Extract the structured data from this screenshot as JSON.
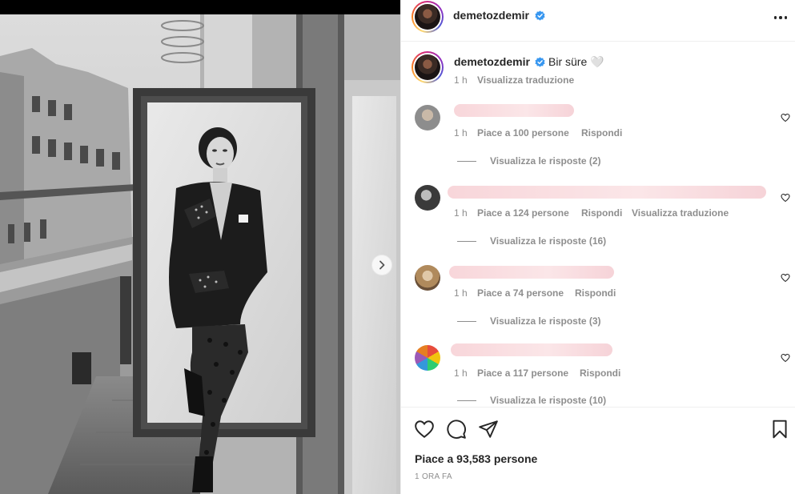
{
  "post": {
    "username": "demetozdemir",
    "caption": "Bir süre 🤍",
    "caption_time": "1 h",
    "translate_label": "Visualizza traduzione",
    "likes_label": "Piace a 93,583 persone",
    "posted_ago": "1 ORA FA"
  },
  "comments": [
    {
      "time": "1 h",
      "likes": "Piace a 100 persone",
      "reply": "Rispondi",
      "translate": "",
      "replies": "Visualizza le risposte (2)",
      "avatar": "man-avatar"
    },
    {
      "time": "1 h",
      "likes": "Piace a 124 persone",
      "reply": "Rispondi",
      "translate": "Visualizza traduzione",
      "replies": "Visualizza le risposte (16)",
      "avatar": "man-bw-avatar"
    },
    {
      "time": "1 h",
      "likes": "Piace a 74 persone",
      "reply": "Rispondi",
      "translate": "",
      "replies": "Visualizza le risposte (3)",
      "avatar": "woman-avatar"
    },
    {
      "time": "1 h",
      "likes": "Piace a 117 persone",
      "reply": "Rispondi",
      "translate": "",
      "replies": "Visualizza le risposte (10)",
      "avatar": "colorful-avatar"
    }
  ],
  "icons": {
    "heart": "heart-icon",
    "comment": "comment-icon",
    "share": "paper-plane-icon",
    "save": "bookmark-icon",
    "more": "ellipsis-icon",
    "next": "chevron-right-icon",
    "verified": "verified-badge-icon"
  },
  "colors": {
    "verified": "#3897f0",
    "secondary_text": "#8e8e8e",
    "primary_text": "#262626",
    "border": "#efefef"
  }
}
